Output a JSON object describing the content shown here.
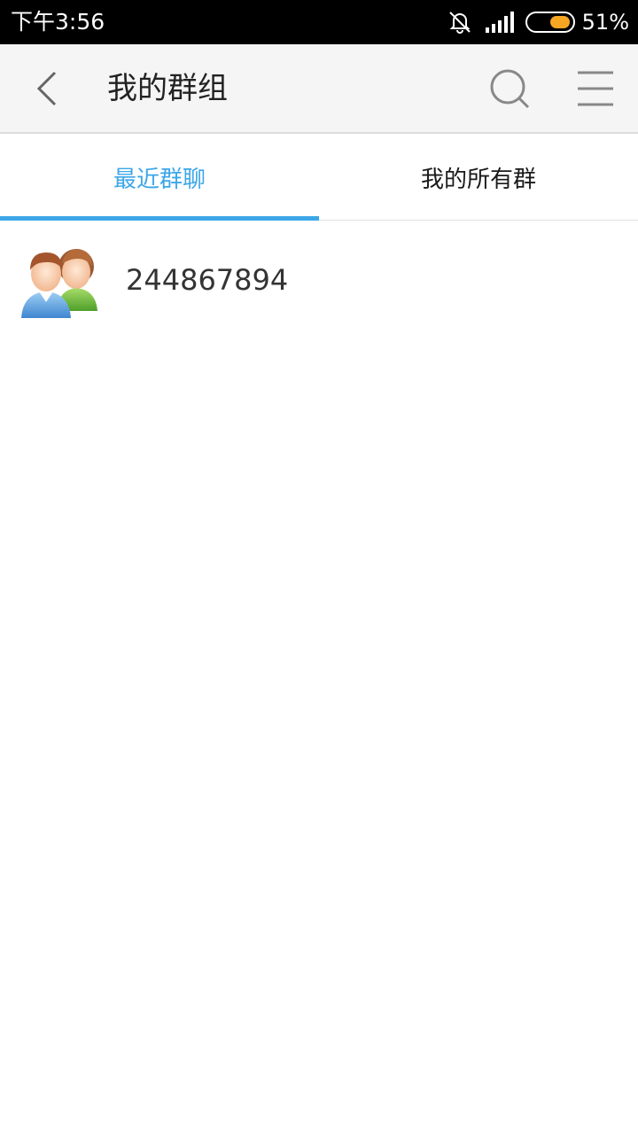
{
  "status_bar": {
    "time": "下午3:56",
    "battery_percent_label": "51%",
    "battery_level": 0.51,
    "icons": [
      "bell-off-icon",
      "signal-icon",
      "battery-icon"
    ]
  },
  "header": {
    "title": "我的群组",
    "icons": [
      "back-arrow-icon",
      "search-icon",
      "menu-icon"
    ]
  },
  "tabs": [
    {
      "label": "最近群聊",
      "active": true
    },
    {
      "label": "我的所有群",
      "active": false
    }
  ],
  "groups": [
    {
      "name": "244867894",
      "icon": "group-avatar-icon"
    }
  ],
  "colors": {
    "accent": "#3ca7e8",
    "battery_fill": "#f5a623",
    "header_bg": "#f5f5f5",
    "status_bar_bg": "#000000"
  }
}
